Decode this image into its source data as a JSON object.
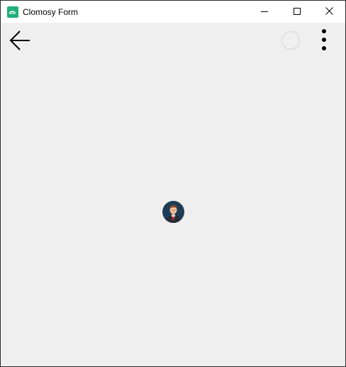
{
  "window": {
    "title": "Clomosy Form",
    "app_icon": "clomosy-app-icon",
    "app_icon_color": "#1fb07a"
  },
  "window_controls": {
    "minimize_icon": "minimize-icon",
    "maximize_icon": "maximize-icon",
    "close_icon": "close-icon"
  },
  "toolbar": {
    "back_icon": "arrow-left-icon",
    "loading_indicator": "loading-ring",
    "menu_icon": "more-vertical-icon"
  },
  "content": {
    "avatar_icon": "user-avatar-icon",
    "background_color": "#efefef"
  }
}
